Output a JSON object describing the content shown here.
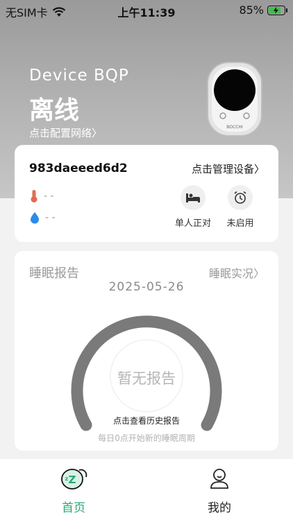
{
  "status_bar": {
    "carrier": "无SIM卡",
    "time": "上午11:39",
    "battery_percent": "85%",
    "battery_level": 0.85
  },
  "device": {
    "name": "Device BQP",
    "status": "离线",
    "config_link": "点击配置网络",
    "product_brand": "BOCCHI"
  },
  "device_card": {
    "device_id": "983daeeed6d2",
    "manage_link": "点击管理设备",
    "temperature": "- -",
    "humidity": "- -",
    "modes": [
      {
        "label": "单人正对",
        "icon": "bed-icon"
      },
      {
        "label": "未启用",
        "icon": "alarm-clock-icon"
      }
    ]
  },
  "sleep_report": {
    "title": "睡眠报告",
    "live_link": "睡眠实况",
    "date": "2025-05-26",
    "empty_text": "暂无报告",
    "history_link": "点击查看历史报告",
    "cycle_note": "每日0点开始新的睡眠周期"
  },
  "tabbar": {
    "tabs": [
      {
        "label": "首页",
        "icon": "home-sleep-icon",
        "active": true
      },
      {
        "label": "我的",
        "icon": "person-icon",
        "active": false
      }
    ]
  },
  "colors": {
    "accent": "#2aa876",
    "hero_top": "#9a9a9a",
    "gauge": "#7a7a7a"
  }
}
